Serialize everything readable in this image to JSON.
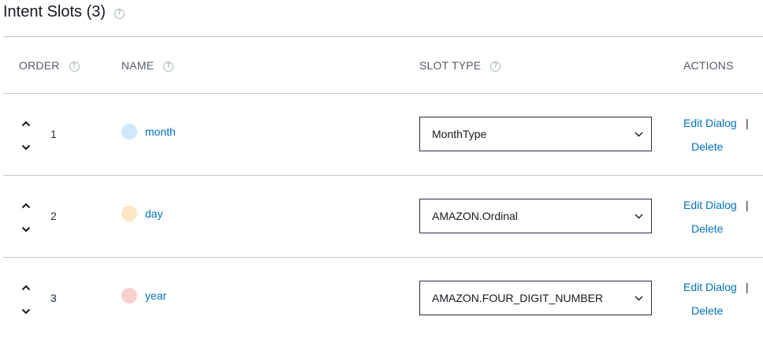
{
  "title": "Intent Slots (3)",
  "help_glyph": "?",
  "columns": {
    "order": "ORDER",
    "name": "NAME",
    "slot_type": "SLOT TYPE",
    "actions": "ACTIONS"
  },
  "actions": {
    "edit": "Edit Dialog",
    "separator": "|",
    "delete": "Delete"
  },
  "slots": [
    {
      "order": "1",
      "name": "month",
      "type": "MonthType",
      "color": "#cfe8fb"
    },
    {
      "order": "2",
      "name": "day",
      "type": "AMAZON.Ordinal",
      "color": "#fde6c4"
    },
    {
      "order": "3",
      "name": "year",
      "type": "AMAZON.FOUR_DIGIT_NUMBER",
      "color": "#fbd0d0"
    }
  ],
  "colors": {
    "link": "#0073bb",
    "border": "#c4c9cc"
  }
}
